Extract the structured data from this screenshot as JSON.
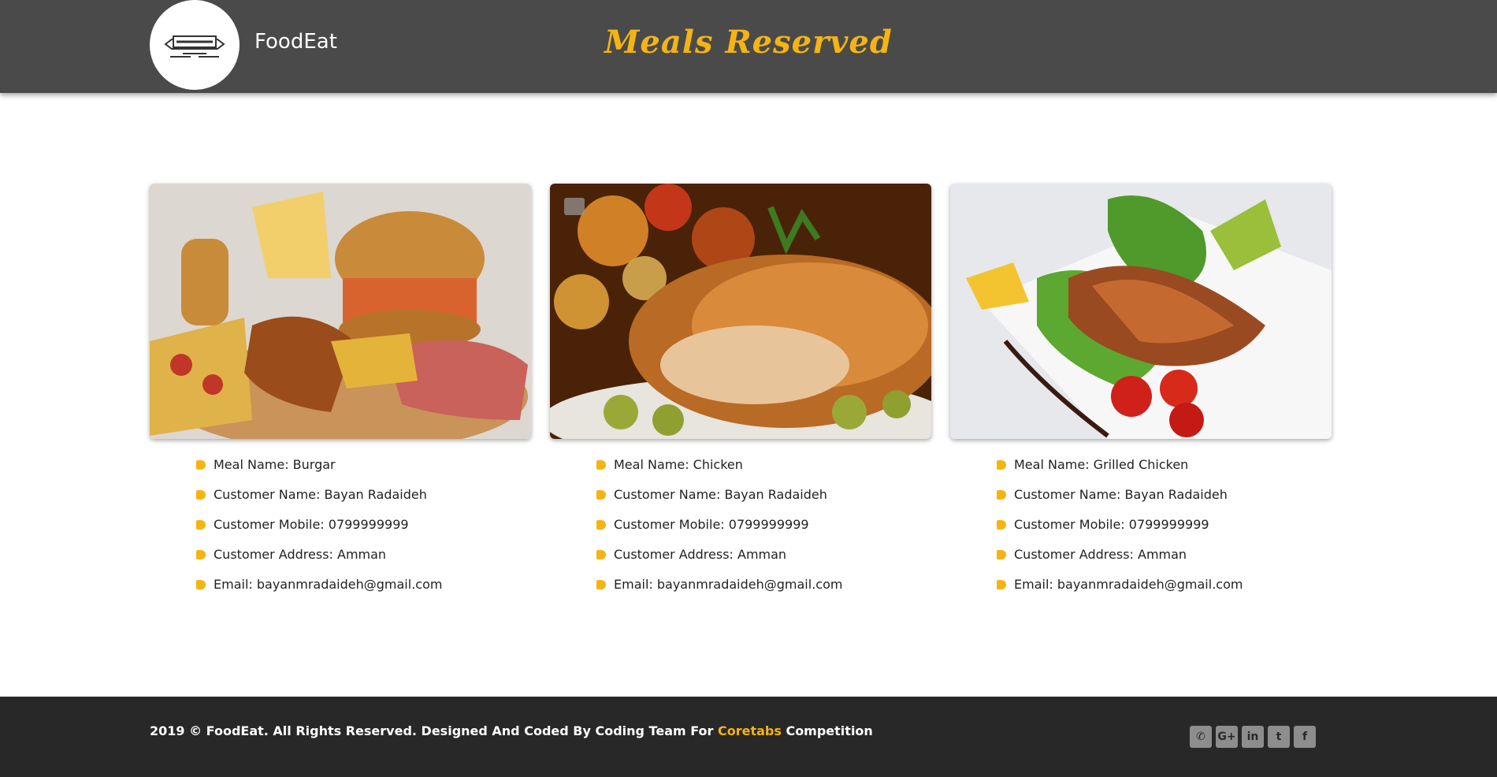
{
  "header": {
    "brand": "FoodEat",
    "logo_icon": "restaurant-logo-icon",
    "title": "Meals Reserved"
  },
  "meals": [
    {
      "image_icon": "burger-platter-image",
      "name": "Meal Name: Burgar",
      "customer": "Customer Name: Bayan Radaideh",
      "mobile": "Customer Mobile: 0799999999",
      "address": "Customer Address: Amman",
      "email": "Email: bayanmradaideh@gmail.com"
    },
    {
      "image_icon": "roast-chicken-image",
      "name": "Meal Name: Chicken",
      "customer": "Customer Name: Bayan Radaideh",
      "mobile": "Customer Mobile: 0799999999",
      "address": "Customer Address: Amman",
      "email": "Email: bayanmradaideh@gmail.com"
    },
    {
      "image_icon": "grilled-salmon-image",
      "name": "Meal Name: Grilled Chicken",
      "customer": "Customer Name: Bayan Radaideh",
      "mobile": "Customer Mobile: 0799999999",
      "address": "Customer Address: Amman",
      "email": "Email: bayanmradaideh@gmail.com"
    }
  ],
  "footer": {
    "copyright": "2019 © FoodEat. All Rights Reserved. Designed And Coded By Coding Team For ",
    "link": "Coretabs",
    "suffix": " Competition",
    "socials": [
      {
        "icon": "phone-icon",
        "glyph": "✆"
      },
      {
        "icon": "google-plus-icon",
        "glyph": "G+"
      },
      {
        "icon": "linkedin-icon",
        "glyph": "in"
      },
      {
        "icon": "twitter-icon",
        "glyph": "t"
      },
      {
        "icon": "facebook-icon",
        "glyph": "f"
      }
    ]
  },
  "colors": {
    "accent": "#f5b412",
    "header_bg": "#4a4a4a",
    "footer_bg": "#282828"
  }
}
